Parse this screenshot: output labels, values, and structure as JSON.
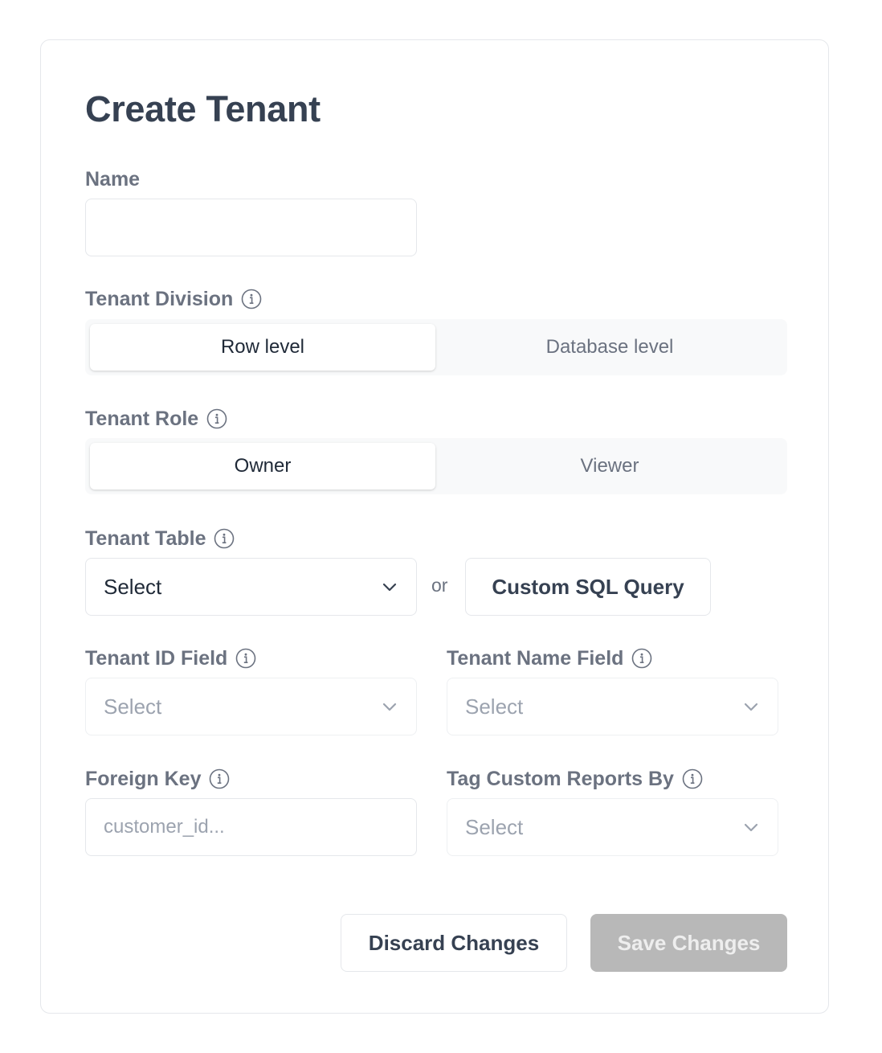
{
  "form": {
    "title": "Create Tenant",
    "name": {
      "label": "Name",
      "value": "",
      "placeholder": ""
    },
    "tenant_division": {
      "label": "Tenant Division",
      "options": [
        "Row level",
        "Database level"
      ],
      "selected": "Row level"
    },
    "tenant_role": {
      "label": "Tenant Role",
      "options": [
        "Owner",
        "Viewer"
      ],
      "selected": "Owner"
    },
    "tenant_table": {
      "label": "Tenant Table",
      "value": "Select",
      "or_text": "or",
      "custom_sql_label": "Custom SQL Query"
    },
    "tenant_id_field": {
      "label": "Tenant ID Field",
      "value": "Select"
    },
    "tenant_name_field": {
      "label": "Tenant Name Field",
      "value": "Select"
    },
    "foreign_key": {
      "label": "Foreign Key",
      "value": "",
      "placeholder": "customer_id..."
    },
    "tag_custom_reports_by": {
      "label": "Tag Custom Reports By",
      "value": "Select"
    }
  },
  "actions": {
    "discard_label": "Discard Changes",
    "save_label": "Save Changes"
  },
  "icons": {
    "info": "info-icon",
    "chevron": "chevron-down-icon"
  },
  "colors": {
    "heading": "#364152",
    "label": "#6b7280",
    "border": "#e5e7eb",
    "segment_bg": "#f8f9fa",
    "save_disabled_bg": "#b8b8b8"
  }
}
